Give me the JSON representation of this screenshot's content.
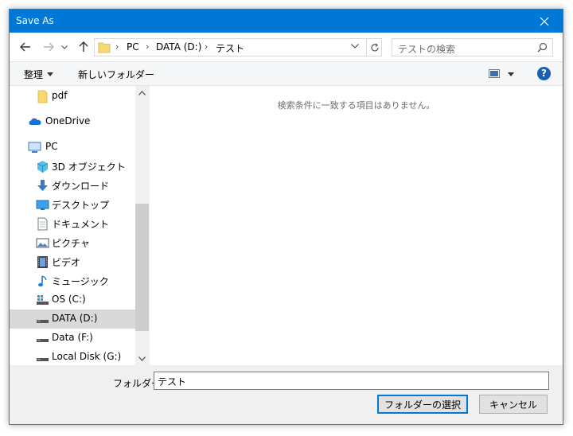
{
  "window": {
    "title": "Save As"
  },
  "address": {
    "crumbs": [
      "PC",
      "DATA (D:)",
      "テスト"
    ]
  },
  "search": {
    "placeholder": "テストの検索"
  },
  "toolbar": {
    "organize_label": "整理",
    "new_folder_label": "新しいフォルダー",
    "help_label": "?"
  },
  "nav": {
    "items": [
      {
        "label": "pdf",
        "icon": "folder-icon"
      },
      {
        "label": "OneDrive",
        "icon": "onedrive-cloud-icon"
      },
      {
        "label": "PC",
        "icon": "pc-icon"
      },
      {
        "label": "3D オブジェクト",
        "icon": "3d-objects-icon"
      },
      {
        "label": "ダウンロード",
        "icon": "download-icon"
      },
      {
        "label": "デスクトップ",
        "icon": "desktop-icon"
      },
      {
        "label": "ドキュメント",
        "icon": "documents-icon"
      },
      {
        "label": "ピクチャ",
        "icon": "pictures-icon"
      },
      {
        "label": "ビデオ",
        "icon": "videos-icon"
      },
      {
        "label": "ミュージック",
        "icon": "music-icon"
      },
      {
        "label": "OS (C:)",
        "icon": "os-drive-icon"
      },
      {
        "label": "DATA (D:)",
        "icon": "drive-icon",
        "selected": true
      },
      {
        "label": "Data (F:)",
        "icon": "drive-icon"
      },
      {
        "label": "Local Disk (G:)",
        "icon": "drive-icon"
      }
    ]
  },
  "content": {
    "empty_message": "検索条件に一致する項目はありません。"
  },
  "footer": {
    "folder_label": "フォルダー:",
    "folder_value": "テスト",
    "select_button": "フォルダーの選択",
    "cancel_button": "キャンセル"
  },
  "colors": {
    "titlebar": "#0078d7",
    "selection": "#d9d9d9",
    "accent": "#0078d7"
  }
}
